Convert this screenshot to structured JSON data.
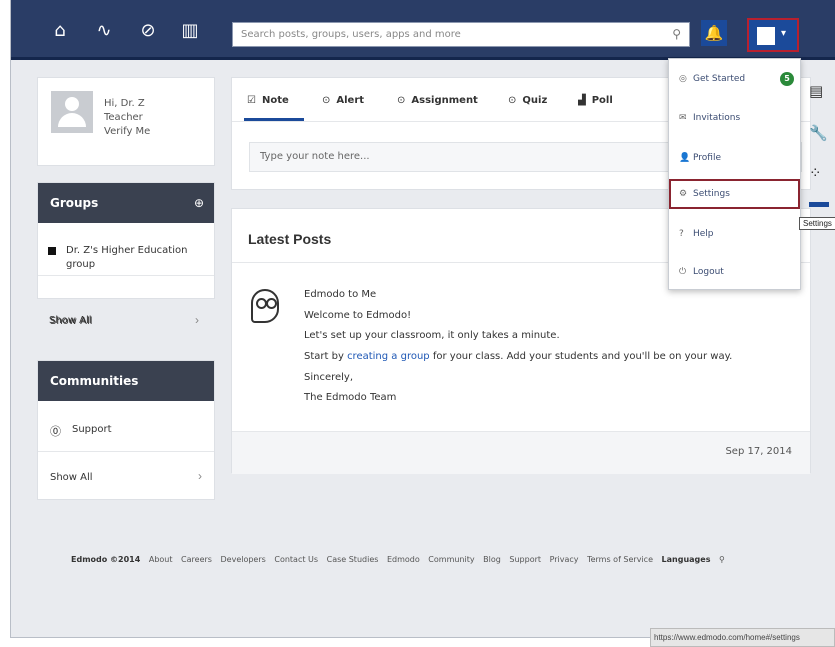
{
  "nav": {
    "icons": [
      "home-icon",
      "pulse-icon",
      "compass-icon",
      "book-icon"
    ],
    "search_placeholder": "Search posts, groups, users, apps and more"
  },
  "profile": {
    "name": "Hi, Dr. Z",
    "role": "Teacher",
    "verify": "Verify Me"
  },
  "groups": {
    "title": "Groups",
    "item": "Dr. Z's Higher Education group",
    "show_all": "Show All"
  },
  "communities": {
    "title": "Communities",
    "item": "Support",
    "show_all": "Show All"
  },
  "composer": {
    "tabs": [
      {
        "label": "Note",
        "icon": "note-icon"
      },
      {
        "label": "Alert",
        "icon": "alert-icon"
      },
      {
        "label": "Assignment",
        "icon": "assignment-icon"
      },
      {
        "label": "Quiz",
        "icon": "quiz-icon"
      },
      {
        "label": "Poll",
        "icon": "poll-icon"
      }
    ],
    "placeholder": "Type your note here..."
  },
  "feed": {
    "title": "Latest Posts",
    "post": {
      "author": "Edmodo to Me",
      "line1": "Welcome to Edmodo!",
      "line2": "Let's set up your classroom, it only takes a minute.",
      "line3_pre": "Start by",
      "line3_link": "creating a group",
      "line3_post": "for your class. Add your students and you'll be on your way.",
      "line4": "Sincerely,",
      "line5": "The Edmodo Team"
    },
    "date": "Sep 17, 2014"
  },
  "menu": {
    "items": [
      {
        "label": "Get Started",
        "icon": "play-icon"
      },
      {
        "label": "Invitations",
        "icon": "envelope-icon"
      },
      {
        "label": "Profile",
        "icon": "user-icon"
      },
      {
        "label": "Settings",
        "icon": "gear-icon"
      },
      {
        "label": "Help",
        "icon": "help-icon"
      },
      {
        "label": "Logout",
        "icon": "logout-icon"
      }
    ],
    "badge": "5"
  },
  "tooltip": "Settings",
  "footer": {
    "copyright": "Edmodo ©2014",
    "links": [
      "About",
      "Careers",
      "Developers",
      "Contact Us",
      "Case Studies",
      "Edmodo",
      "Community",
      "Blog",
      "Support",
      "Privacy",
      "Terms of Service"
    ],
    "language": "Languages"
  },
  "status_url": "https://www.edmodo.com/home#/settings",
  "colors": {
    "topbar": "#2a3d66",
    "accent": "#1b4a9a",
    "highlight": "#b8202e",
    "badge": "#2b8a3a"
  }
}
